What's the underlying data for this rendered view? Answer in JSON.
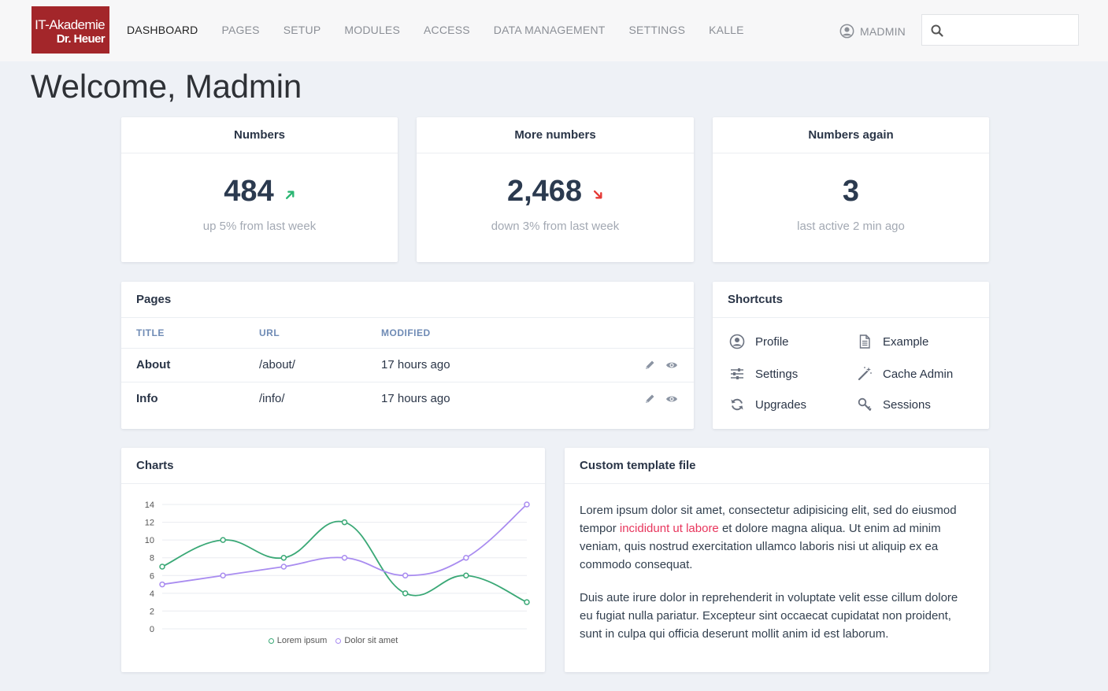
{
  "logo": {
    "line1": "IT-Akademie",
    "line2": "Dr. Heuer",
    "bg_color": "#a3262a"
  },
  "nav": {
    "items": [
      {
        "label": "DASHBOARD",
        "active": true
      },
      {
        "label": "PAGES"
      },
      {
        "label": "SETUP"
      },
      {
        "label": "MODULES"
      },
      {
        "label": "ACCESS"
      },
      {
        "label": "DATA MANAGEMENT"
      },
      {
        "label": "SETTINGS"
      },
      {
        "label": "KALLE"
      }
    ],
    "user": "MADMIN",
    "search": {
      "value": "",
      "placeholder": "",
      "icon": "search-icon"
    }
  },
  "welcome": "Welcome, Madmin",
  "stats": [
    {
      "title": "Numbers",
      "value": "484",
      "trend": "up",
      "trend_icon": "arrow-up-right-icon",
      "trend_color": "#2bb673",
      "sub": "up 5% from last week"
    },
    {
      "title": "More numbers",
      "value": "2,468",
      "trend": "down",
      "trend_icon": "arrow-down-right-icon",
      "trend_color": "#e53935",
      "sub": "down 3% from last week"
    },
    {
      "title": "Numbers again",
      "value": "3",
      "sub": "last active 2 min ago"
    }
  ],
  "pages": {
    "title": "Pages",
    "columns": [
      "TITLE",
      "URL",
      "MODIFIED"
    ],
    "rows": [
      {
        "title": "About",
        "url": "/about/",
        "modified": "17 hours ago"
      },
      {
        "title": "Info",
        "url": "/info/",
        "modified": "17 hours ago"
      }
    ],
    "row_icons": [
      "pencil-icon",
      "eye-icon"
    ]
  },
  "shortcuts": {
    "title": "Shortcuts",
    "items": [
      {
        "label": "Profile",
        "icon": "user-circle-icon"
      },
      {
        "label": "Example",
        "icon": "document-icon"
      },
      {
        "label": "Settings",
        "icon": "sliders-icon"
      },
      {
        "label": "Cache Admin",
        "icon": "magic-wand-icon"
      },
      {
        "label": "Upgrades",
        "icon": "refresh-icon"
      },
      {
        "label": "Sessions",
        "icon": "key-icon"
      }
    ]
  },
  "charts": {
    "title": "Charts"
  },
  "chart_data": {
    "type": "line",
    "x": [
      1,
      2,
      3,
      4,
      5,
      6,
      7
    ],
    "series": [
      {
        "name": "Lorem ipsum",
        "color": "#3aa876",
        "values": [
          7,
          10,
          8,
          12,
          4,
          6,
          3
        ]
      },
      {
        "name": "Dolor sit amet",
        "color": "#a98cf0",
        "values": [
          5,
          6,
          7,
          8,
          6,
          8,
          14
        ]
      }
    ],
    "ylim": [
      0,
      14
    ],
    "yticks": [
      0,
      2,
      4,
      6,
      8,
      10,
      12,
      14
    ],
    "grid": true,
    "legend": "bottom"
  },
  "template": {
    "title": "Custom template file",
    "p1_a": "Lorem ipsum dolor sit amet, consectetur adipisicing elit, sed do eiusmod tempor ",
    "p1_highlight": "incididunt ut labore",
    "p1_b": " et dolore magna aliqua. Ut enim ad minim veniam, quis nostrud exercitation ullamco laboris nisi ut aliquip ex ea commodo consequat.",
    "p2": "Duis aute irure dolor in reprehenderit in voluptate velit esse cillum dolore eu fugiat nulla pariatur. Excepteur sint occaecat cupidatat non proident, sunt in culpa qui officia deserunt mollit anim id est laborum.",
    "highlight_color": "#e8365d"
  }
}
